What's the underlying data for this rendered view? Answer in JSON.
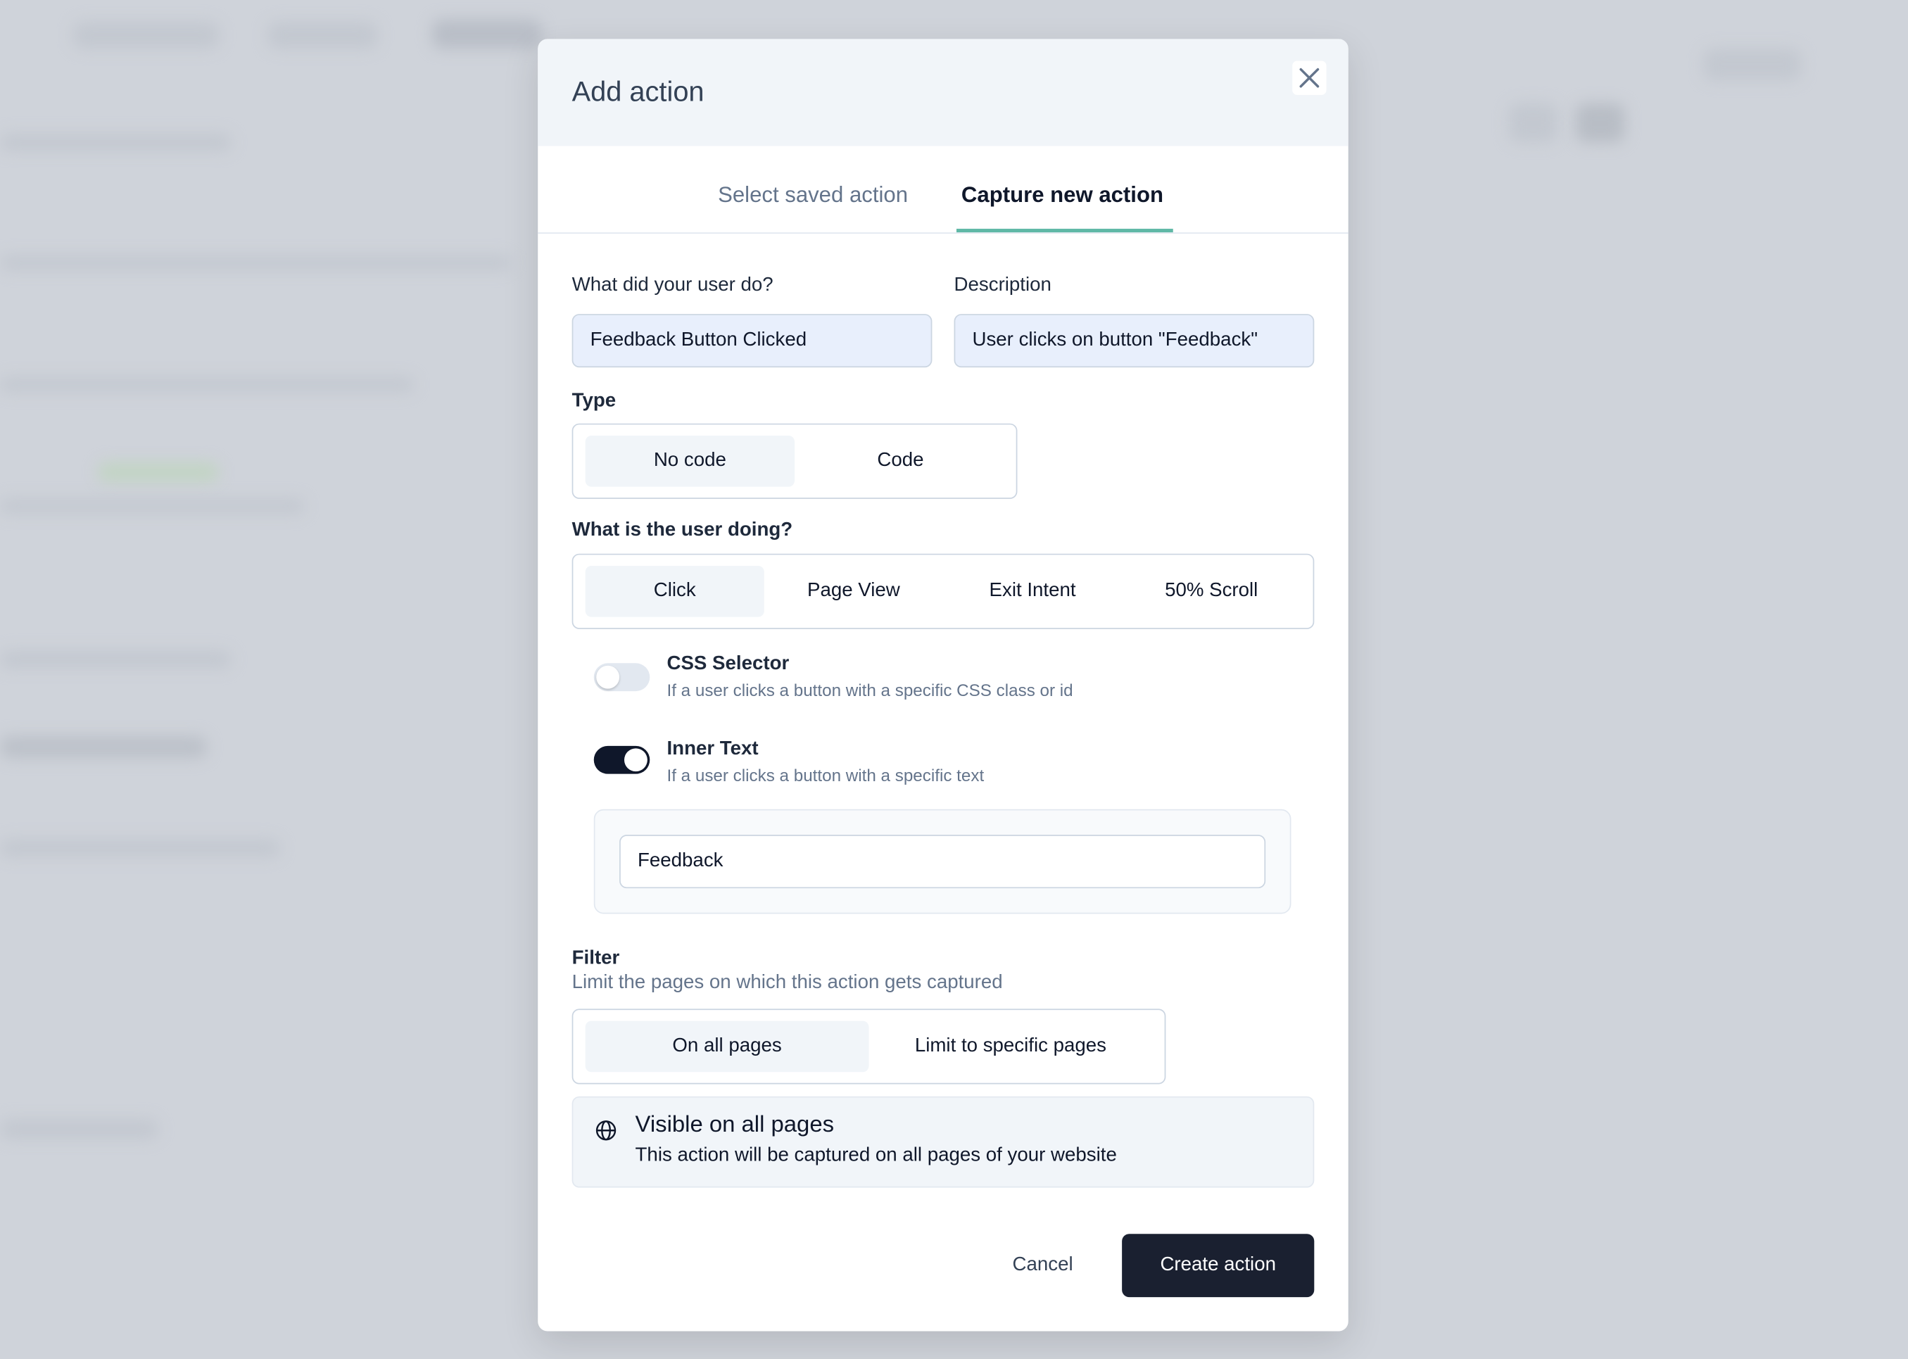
{
  "modal": {
    "title": "Add action",
    "close_icon": "x-icon",
    "tabs": [
      {
        "label": "Select saved action",
        "active": false
      },
      {
        "label": "Capture new action",
        "active": true
      }
    ],
    "accent_color": "#5fb8a6",
    "name_field": {
      "label": "What did your user do?",
      "value": "Feedback Button Clicked"
    },
    "description_field": {
      "label": "Description",
      "value": "User clicks on button \"Feedback\""
    },
    "type": {
      "label": "Type",
      "options": [
        "No code",
        "Code"
      ],
      "selected": "No code"
    },
    "user_doing": {
      "label": "What is the user doing?",
      "options": [
        "Click",
        "Page View",
        "Exit Intent",
        "50% Scroll"
      ],
      "selected": "Click"
    },
    "css_selector": {
      "title": "CSS Selector",
      "description": "If a user clicks a button with a specific CSS class or id",
      "enabled": false
    },
    "inner_text": {
      "title": "Inner Text",
      "description": "If a user clicks a button with a specific text",
      "enabled": true,
      "value": "Feedback"
    },
    "filter": {
      "label": "Filter",
      "description": "Limit the pages on which this action gets captured",
      "options": [
        "On all pages",
        "Limit to specific pages"
      ],
      "selected": "On all pages",
      "info_icon": "globe-icon",
      "info_title": "Visible on all pages",
      "info_text": "This action will be captured on all pages of your website"
    },
    "cancel_label": "Cancel",
    "create_label": "Create action"
  }
}
